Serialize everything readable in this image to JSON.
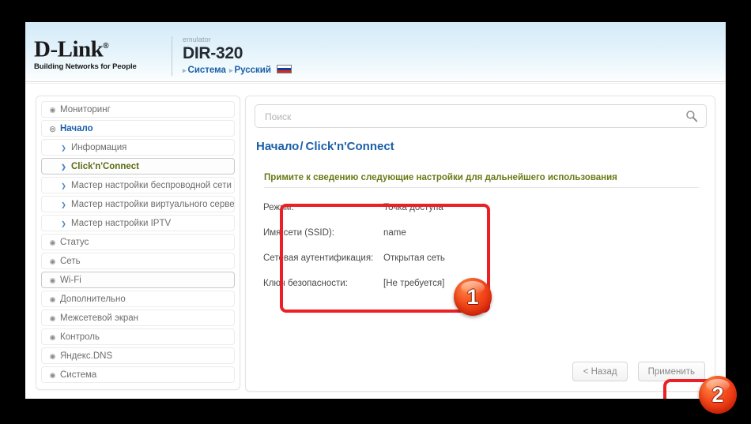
{
  "header": {
    "logo_main": "D-Link",
    "logo_registered": "®",
    "logo_tagline": "Building Networks for People",
    "emulator_label": "emulator",
    "model": "DIR-320",
    "link_system": "Система",
    "link_language": "Русский",
    "flag_name": "russian-flag"
  },
  "sidebar": {
    "items": [
      {
        "label": "Мониторинг",
        "type": "top",
        "state": "normal",
        "icon": "circle-arrow-icon"
      },
      {
        "label": "Начало",
        "type": "top",
        "state": "expanded",
        "icon": "circle-chevron-down-icon"
      },
      {
        "label": "Информация",
        "type": "sub",
        "state": "normal",
        "icon": "chevron-right-icon"
      },
      {
        "label": "Click'n'Connect",
        "type": "sub",
        "state": "current",
        "icon": "chevron-right-icon"
      },
      {
        "label": "Мастер настройки беспроводной сети",
        "type": "sub",
        "state": "normal",
        "icon": "chevron-right-icon"
      },
      {
        "label": "Мастер настройки виртуального сервера",
        "type": "sub",
        "state": "normal",
        "icon": "chevron-right-icon"
      },
      {
        "label": "Мастер настройки IPTV",
        "type": "sub",
        "state": "normal",
        "icon": "chevron-right-icon"
      },
      {
        "label": "Статус",
        "type": "top",
        "state": "normal",
        "icon": "circle-arrow-icon"
      },
      {
        "label": "Сеть",
        "type": "top",
        "state": "normal",
        "icon": "circle-arrow-icon"
      },
      {
        "label": "Wi-Fi",
        "type": "top",
        "state": "hover",
        "icon": "circle-arrow-icon"
      },
      {
        "label": "Дополнительно",
        "type": "top",
        "state": "normal",
        "icon": "circle-arrow-icon"
      },
      {
        "label": "Межсетевой экран",
        "type": "top",
        "state": "normal",
        "icon": "circle-arrow-icon"
      },
      {
        "label": "Контроль",
        "type": "top",
        "state": "normal",
        "icon": "circle-arrow-icon"
      },
      {
        "label": "Яндекс.DNS",
        "type": "top",
        "state": "normal",
        "icon": "circle-arrow-icon"
      },
      {
        "label": "Система",
        "type": "top",
        "state": "normal",
        "icon": "circle-arrow-icon"
      }
    ]
  },
  "main": {
    "search": {
      "placeholder": "Поиск",
      "value": "",
      "icon": "search-icon"
    },
    "breadcrumb": {
      "root": "Начало",
      "separator": "/",
      "current": "Click'n'Connect"
    },
    "section_title": "Примите к сведению следующие настройки для дальнейшего использования",
    "settings": [
      {
        "label": "Режим:",
        "value": "Точка доступа"
      },
      {
        "label": "Имя сети (SSID):",
        "value": "name"
      },
      {
        "label": "Сетевая аутентификация:",
        "value": "Открытая сеть"
      },
      {
        "label": "Ключ безопасности:",
        "value": "[Не требуется]"
      }
    ],
    "buttons": {
      "back": "< Назад",
      "apply": "Применить"
    }
  },
  "annotations": {
    "badge_1": "1",
    "badge_2": "2",
    "highlight_color": "#ec2024"
  }
}
